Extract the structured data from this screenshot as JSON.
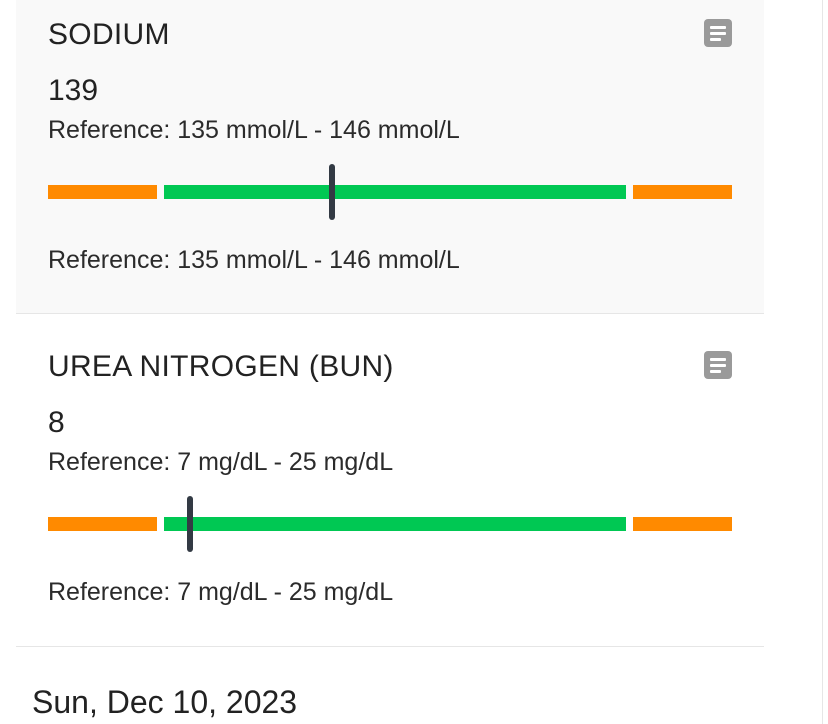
{
  "colors": {
    "out_of_range": "#ff8a00",
    "in_range": "#00c853",
    "marker": "#333a44",
    "card_bg": "#f9f9f9"
  },
  "results": [
    {
      "name": "SODIUM",
      "value": "139",
      "reference_top": "Reference: 135 mmol/L - 146 mmol/L",
      "reference_bottom": "Reference: 135 mmol/L - 146 mmol/L",
      "ref_low": 135,
      "ref_high": 146,
      "measured": 139,
      "icon": "document-icon"
    },
    {
      "name": "UREA NITROGEN (BUN)",
      "value": "8",
      "reference_top": "Reference: 7 mg/dL - 25 mg/dL",
      "reference_bottom": "Reference: 7 mg/dL - 25 mg/dL",
      "ref_low": 7,
      "ref_high": 25,
      "measured": 8,
      "icon": "document-icon"
    }
  ],
  "date_header": "Sun, Dec 10, 2023"
}
